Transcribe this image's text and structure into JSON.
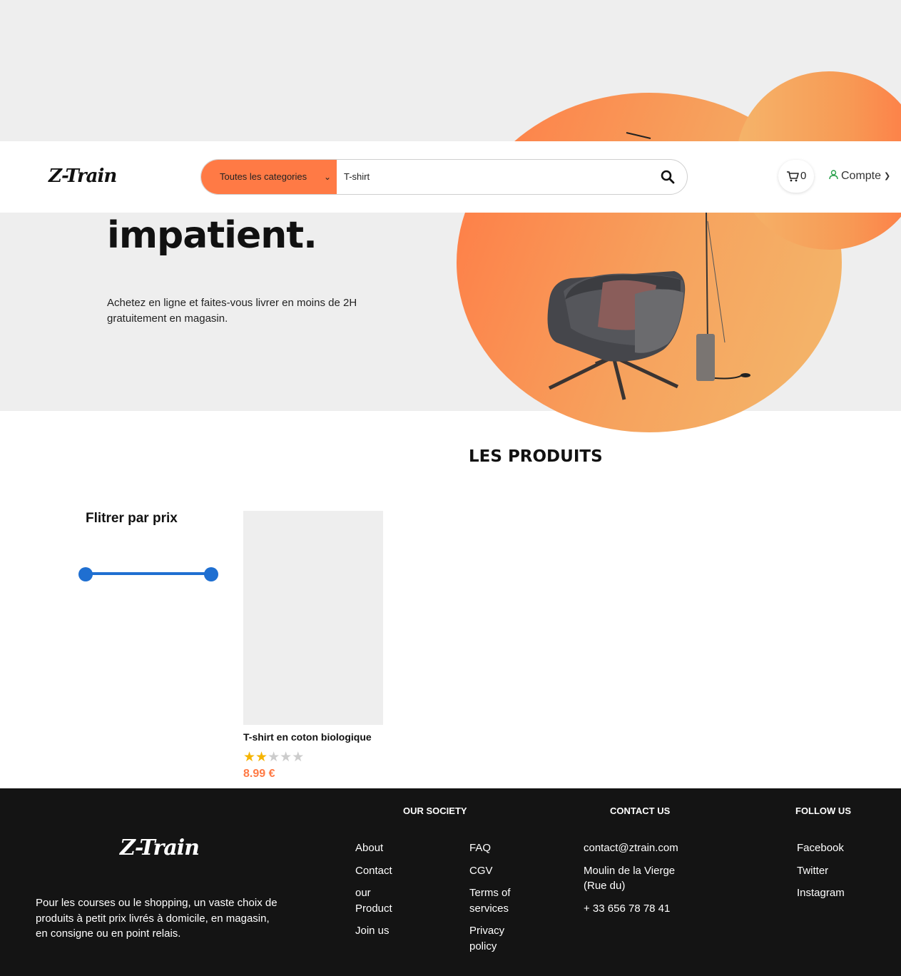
{
  "hero": {
    "title": "impatient.",
    "text": "Achetez en ligne et faites-vous livrer en moins de 2H gratuitement en magasin."
  },
  "header": {
    "logo": "Z-Train",
    "category_select": "Toutes les categories",
    "search_value": "T-shirt",
    "cart_count": "0",
    "account_label": "Compte"
  },
  "products": {
    "section_title": "LES PRODUITS",
    "filter_title": "Flitrer par prix",
    "items": [
      {
        "name": "T-shirt en coton biologique",
        "rating": 2,
        "rating_max": 5,
        "price": "8.99 €"
      }
    ]
  },
  "footer": {
    "logo": "Z-Train",
    "description": "Pour les courses ou le shopping, un vaste choix de produits à petit prix livrés à domicile, en magasin, en consigne ou en point relais.",
    "society": {
      "heading": "OUR SOCIETY",
      "col1": [
        "About",
        "Contact",
        "our Product",
        "Join us"
      ],
      "col2": [
        "FAQ",
        "CGV",
        "Terms of services",
        "Privacy policy"
      ]
    },
    "contact": {
      "heading": "CONTACT US",
      "email": "contact@ztrain.com",
      "address": "Moulin de la Vierge (Rue du)",
      "phone": "+ 33 656 78 78 41"
    },
    "follow": {
      "heading": "FOLLOW US",
      "links": [
        "Facebook",
        "Twitter",
        "Instagram"
      ]
    }
  },
  "colors": {
    "accent": "#ff7a45",
    "slider": "#1f6fd1",
    "star": "#f5b400",
    "footer_bg": "#141414"
  }
}
